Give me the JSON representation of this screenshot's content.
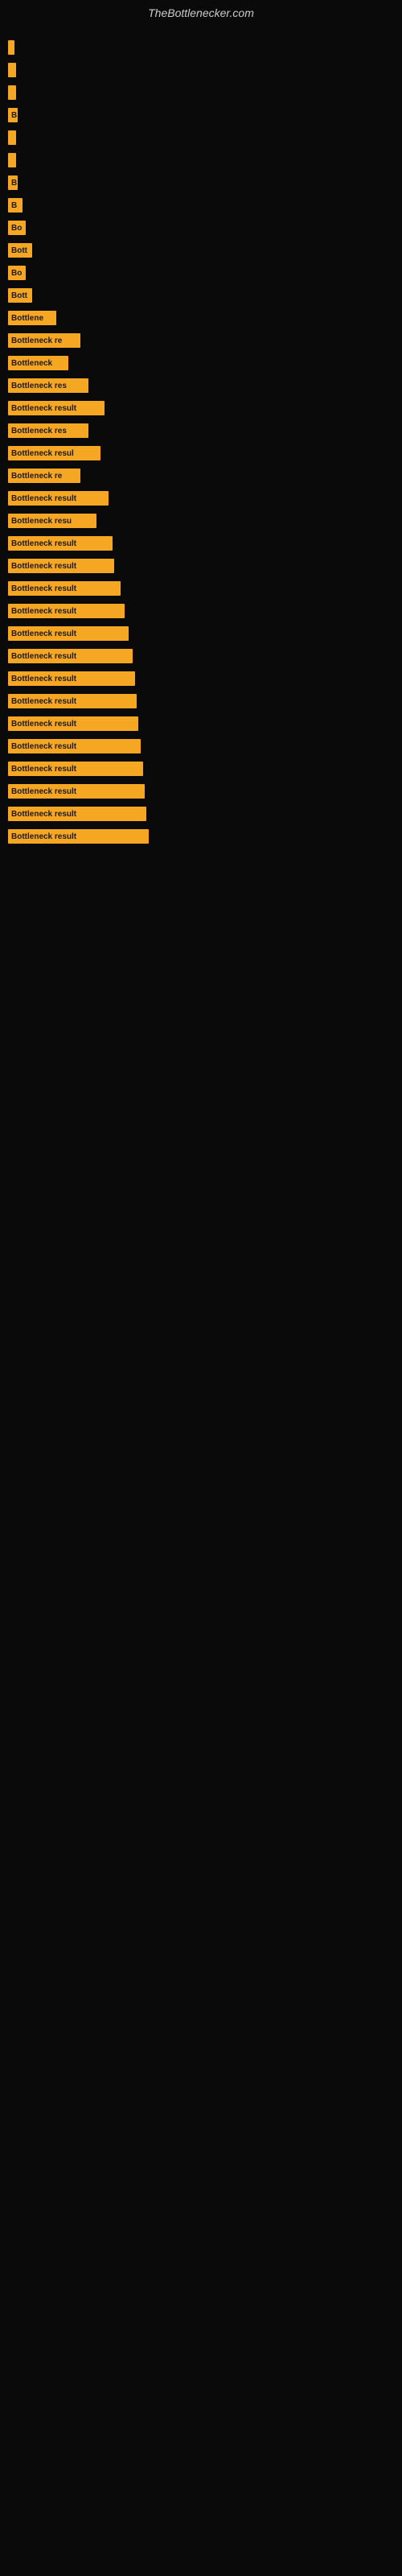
{
  "site": {
    "title": "TheBottlenecker.com"
  },
  "bars": [
    {
      "id": 1,
      "label": "",
      "width": 8
    },
    {
      "id": 2,
      "label": "",
      "width": 10
    },
    {
      "id": 3,
      "label": "",
      "width": 10
    },
    {
      "id": 4,
      "label": "B",
      "width": 12
    },
    {
      "id": 5,
      "label": "",
      "width": 10
    },
    {
      "id": 6,
      "label": "",
      "width": 10
    },
    {
      "id": 7,
      "label": "B",
      "width": 12
    },
    {
      "id": 8,
      "label": "B",
      "width": 18
    },
    {
      "id": 9,
      "label": "Bo",
      "width": 22
    },
    {
      "id": 10,
      "label": "Bott",
      "width": 30
    },
    {
      "id": 11,
      "label": "Bo",
      "width": 22
    },
    {
      "id": 12,
      "label": "Bott",
      "width": 30
    },
    {
      "id": 13,
      "label": "Bottlene",
      "width": 60
    },
    {
      "id": 14,
      "label": "Bottleneck re",
      "width": 90
    },
    {
      "id": 15,
      "label": "Bottleneck",
      "width": 75
    },
    {
      "id": 16,
      "label": "Bottleneck res",
      "width": 100
    },
    {
      "id": 17,
      "label": "Bottleneck result",
      "width": 120
    },
    {
      "id": 18,
      "label": "Bottleneck res",
      "width": 100
    },
    {
      "id": 19,
      "label": "Bottleneck resul",
      "width": 115
    },
    {
      "id": 20,
      "label": "Bottleneck re",
      "width": 90
    },
    {
      "id": 21,
      "label": "Bottleneck result",
      "width": 125
    },
    {
      "id": 22,
      "label": "Bottleneck resu",
      "width": 110
    },
    {
      "id": 23,
      "label": "Bottleneck result",
      "width": 130
    },
    {
      "id": 24,
      "label": "Bottleneck result",
      "width": 132
    },
    {
      "id": 25,
      "label": "Bottleneck result",
      "width": 140
    },
    {
      "id": 26,
      "label": "Bottleneck result",
      "width": 145
    },
    {
      "id": 27,
      "label": "Bottleneck result",
      "width": 150
    },
    {
      "id": 28,
      "label": "Bottleneck result",
      "width": 155
    },
    {
      "id": 29,
      "label": "Bottleneck result",
      "width": 158
    },
    {
      "id": 30,
      "label": "Bottleneck result",
      "width": 160
    },
    {
      "id": 31,
      "label": "Bottleneck result",
      "width": 162
    },
    {
      "id": 32,
      "label": "Bottleneck result",
      "width": 165
    },
    {
      "id": 33,
      "label": "Bottleneck result",
      "width": 168
    },
    {
      "id": 34,
      "label": "Bottleneck result",
      "width": 170
    },
    {
      "id": 35,
      "label": "Bottleneck result",
      "width": 172
    },
    {
      "id": 36,
      "label": "Bottleneck result",
      "width": 175
    }
  ]
}
